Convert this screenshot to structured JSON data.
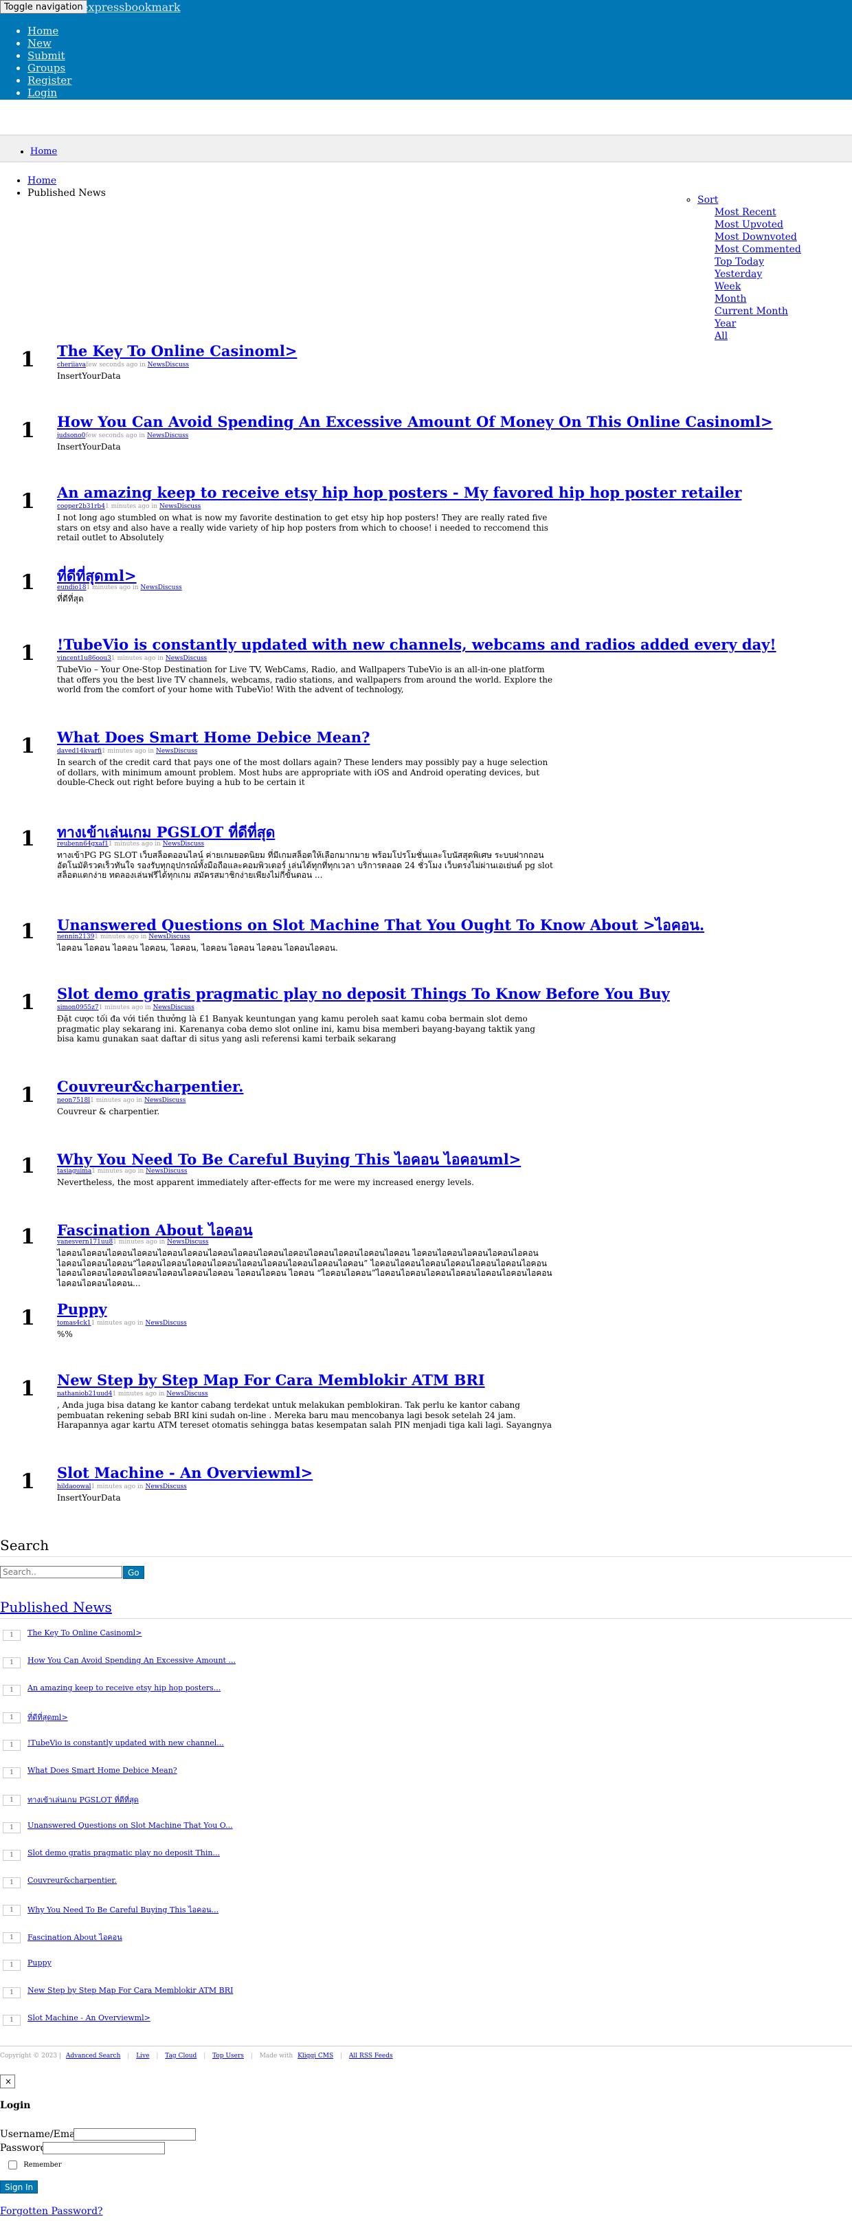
{
  "nav": {
    "toggle_label": "Toggle navigation",
    "brand": "expressbookmark",
    "links": [
      "Home",
      "New",
      "Submit",
      "Groups",
      "Register",
      "Login"
    ]
  },
  "breadcrumb_bar": {
    "home": "Home"
  },
  "breadcrumb": {
    "home": "Home",
    "current": "Published News"
  },
  "sort": {
    "label": "Sort",
    "options": [
      "Most Recent",
      "Most Upvoted",
      "Most Downvoted",
      "Most Commented",
      "Top Today",
      "Yesterday",
      "Week",
      "Month",
      "Current Month",
      "Year",
      "All"
    ]
  },
  "stories": [
    {
      "votes": "1",
      "title": "The Key To Online Casinoml>",
      "user": "cheriiava",
      "time": "few seconds ago",
      "category": "NewsDiscuss",
      "body": "InsertYourData"
    },
    {
      "votes": "1",
      "title": "How You Can Avoid Spending An Excessive Amount Of Money On This Online Casinoml>",
      "user": "judsono0",
      "time": "few seconds ago",
      "category": "NewsDiscuss",
      "body": "InsertYourData"
    },
    {
      "votes": "1",
      "title": "An amazing keep to receive etsy hip hop posters - My favored hip hop poster retailer",
      "user": "cooper2b31rb4",
      "time": "1 minutes ago",
      "category": "NewsDiscuss",
      "body": "I not long ago stumbled on what is now my favorite destination to get etsy hip hop posters! They are really rated five stars on etsy and also have a really wide variety of hip hop posters from which to choose! i needed to reccomend this retail outlet to Absolutely"
    },
    {
      "votes": "1",
      "title": "ที่ดีที่สุดml>",
      "user": "eundio18",
      "time": "1 minutes ago",
      "category": "NewsDiscuss",
      "body": "ที่ดีที่สุด"
    },
    {
      "votes": "1",
      "title": "!TubeVio is constantly updated with new channels, webcams and radios added every day!",
      "user": "vincent1u86oou3",
      "time": "1 minutes ago",
      "category": "NewsDiscuss",
      "body": "TubeVio – Your One-Stop Destination for Live TV, WebCams, Radio, and Wallpapers TubeVio is an all-in-one platform that offers you the best live TV channels, webcams, radio stations, and wallpapers from around the world. Explore the world from the comfort of your home with TubeVio! With the advent of technology,"
    },
    {
      "votes": "1",
      "title": "What Does Smart Home Debice Mean?",
      "user": "daved14kvarfi",
      "time": "1 minutes ago",
      "category": "NewsDiscuss",
      "body": "In search of the credit card that pays one of the most dollars again? These lenders may possibly pay a huge selection of dollars, with minimum amount problem. Most hubs are appropriate with iOS and Android operating devices, but double-Check out right before buying a hub to be certain it"
    },
    {
      "votes": "1",
      "title": "ทางเข้าเล่นเกม PGSLOT ที่ดีที่สุด",
      "user": "reubenn64gxaf1",
      "time": "1 minutes ago",
      "category": "NewsDiscuss",
      "body": "ทางเข้าPG PG SLOT เว็บสล็อตออนไลน์ ค่ายเกมยอดนิยม ที่มีเกมสล็อตให้เลือกมากมาย พร้อมโปรโมชั่นและโบนัสสุดพิเศษ ระบบฝากถอนอัตโนมัติรวดเร็วทันใจ รองรับทุกอุปกรณ์ทั้งมือถือและคอมพิวเตอร์ เล่นได้ทุกที่ทุกเวลา บริการตลอด 24 ชั่วโมง เว็บตรงไม่ผ่านเอเย่นต์ pg slot สล็อตแตกง่าย ทดลองเล่นฟรีได้ทุกเกม สมัครสมาชิกง่ายเพียงไม่กี่ขั้นตอน ..."
    },
    {
      "votes": "1",
      "title": "Unanswered Questions on Slot Machine That You Ought To Know About >ไอคอน.",
      "user": "nennin2139",
      "time": "1 minutes ago",
      "category": "NewsDiscuss",
      "body": "ไอคอน ไอคอน ไอคอน ไอคอน, ไอคอน, ไอคอน ไอคอน ไอคอน ไอคอนไอคอน."
    },
    {
      "votes": "1",
      "title": "Slot demo gratis pragmatic play no deposit Things To Know Before You Buy",
      "user": "simon0955z7",
      "time": "1 minutes ago",
      "category": "NewsDiscuss",
      "body": "Đặt cược tối đa với tiền thưởng là £1 Banyak keuntungan yang kamu peroleh saat kamu coba bermain slot demo pragmatic play sekarang ini. Karenanya coba demo slot online ini, kamu bisa memberi bayang-bayang taktik yang bisa kamu gunakan saat daftar di situs yang asli referensi kami terbaik sekarang"
    },
    {
      "votes": "1",
      "title": "Couvreur&charpentier.",
      "user": "neon7518l",
      "time": "1 minutes ago",
      "category": "NewsDiscuss",
      "body": "Couvreur & charpentier."
    },
    {
      "votes": "1",
      "title": "Why You Need To Be Careful Buying This ไอคอน ไอคอนml>",
      "user": "tasiaguima",
      "time": "1 minutes ago",
      "category": "NewsDiscuss",
      "body": "Nevertheless, the most apparent immediately after-effects for me were my increased energy levels."
    },
    {
      "votes": "1",
      "title": "Fascination About ไอคอน",
      "user": "vanesvern171uu8",
      "time": "1 minutes ago",
      "category": "NewsDiscuss",
      "body": "ไอคอนไอคอนไอคอนไอคอนไอคอนไอคอนไอคอนไอคอนไอคอนไอคอนไอคอนไอคอนไอคอนไอคอน ไอคอนไอคอนไอคอนไอคอนไอคอนไอคอนไอคอนไอคอน“ไอคอนไอคอนไอคอนไอคอนไอคอนไอคอนไอคอนไอคอนไอคอน” ไอคอนไอคอนไอคอนไอคอนไอคอนไอคอนไอคอนไอคอนไอคอนไอคอนไอคอนไอคอนไอคอนไอคอน ไอคอนไอคอน ไอคอน “ไอคอนไอคอน”ไอคอนไอคอนไอคอนไอคอนไอคอนไอคอนไอคอนไอคอนไอคอนไอคอน..."
    },
    {
      "votes": "1",
      "title": "Puppy",
      "user": "tomas4ck1",
      "time": "1 minutes ago",
      "category": "NewsDiscuss",
      "body": "%%"
    },
    {
      "votes": "1",
      "title": "New Step by Step Map For Cara Memblokir ATM BRI",
      "user": "nathaniob21uud4",
      "time": "1 minutes ago",
      "category": "NewsDiscuss",
      "body": ", Anda juga bisa datang ke kantor cabang terdekat untuk melakukan pemblokiran. Tak perlu ke kantor cabang pembuatan rekening sebab BRI kini sudah on-line . Mereka baru mau mencobanya lagi besok setelah 24 jam. Harapannya agar kartu ATM tereset otomatis sehingga batas kesempatan salah PIN menjadi tiga kali lagi. Sayangnya"
    },
    {
      "votes": "1",
      "title": "Slot Machine - An Overviewml>",
      "user": "hildaoowal",
      "time": "1 minutes ago",
      "category": "NewsDiscuss",
      "body": "InsertYourData"
    }
  ],
  "search": {
    "title": "Search",
    "placeholder": "Search..",
    "button": "Go"
  },
  "published_news": {
    "title": "Published News",
    "items": [
      "The Key To Online Casinoml>",
      "How You Can Avoid Spending An Excessive Amount ...",
      "An amazing keep to receive etsy hip hop posters...",
      "ที่ดีที่สุดml>",
      "!TubeVio is constantly updated with new channel...",
      "What Does Smart Home Debice Mean?",
      "ทางเข้าเล่นเกม PGSLOT ที่ดีที่สุด",
      "Unanswered Questions on Slot Machine That You O...",
      "Slot demo gratis pragmatic play no deposit Thin...",
      "Couvreur&charpentier.",
      "Why You Need To Be Careful Buying This ไอคอน...",
      "Fascination About ไอคอน",
      "Puppy",
      "New Step by Step Map For Cara Memblokir ATM BRI",
      "Slot Machine - An Overviewml>"
    ]
  },
  "footer": {
    "copyright": "Copyright © 2023 |",
    "links": [
      "Advanced Search",
      "Live",
      "Tag Cloud",
      "Top Users"
    ],
    "made_with": "Made with",
    "cms": "Kliqqi CMS",
    "rss": "All RSS Feeds"
  },
  "login": {
    "close": "×",
    "title": "Login",
    "username_label": "Username/Email",
    "password_label": "Password",
    "remember": "Remember",
    "submit": "Sign In",
    "forgot": "Forgotten Password?"
  }
}
